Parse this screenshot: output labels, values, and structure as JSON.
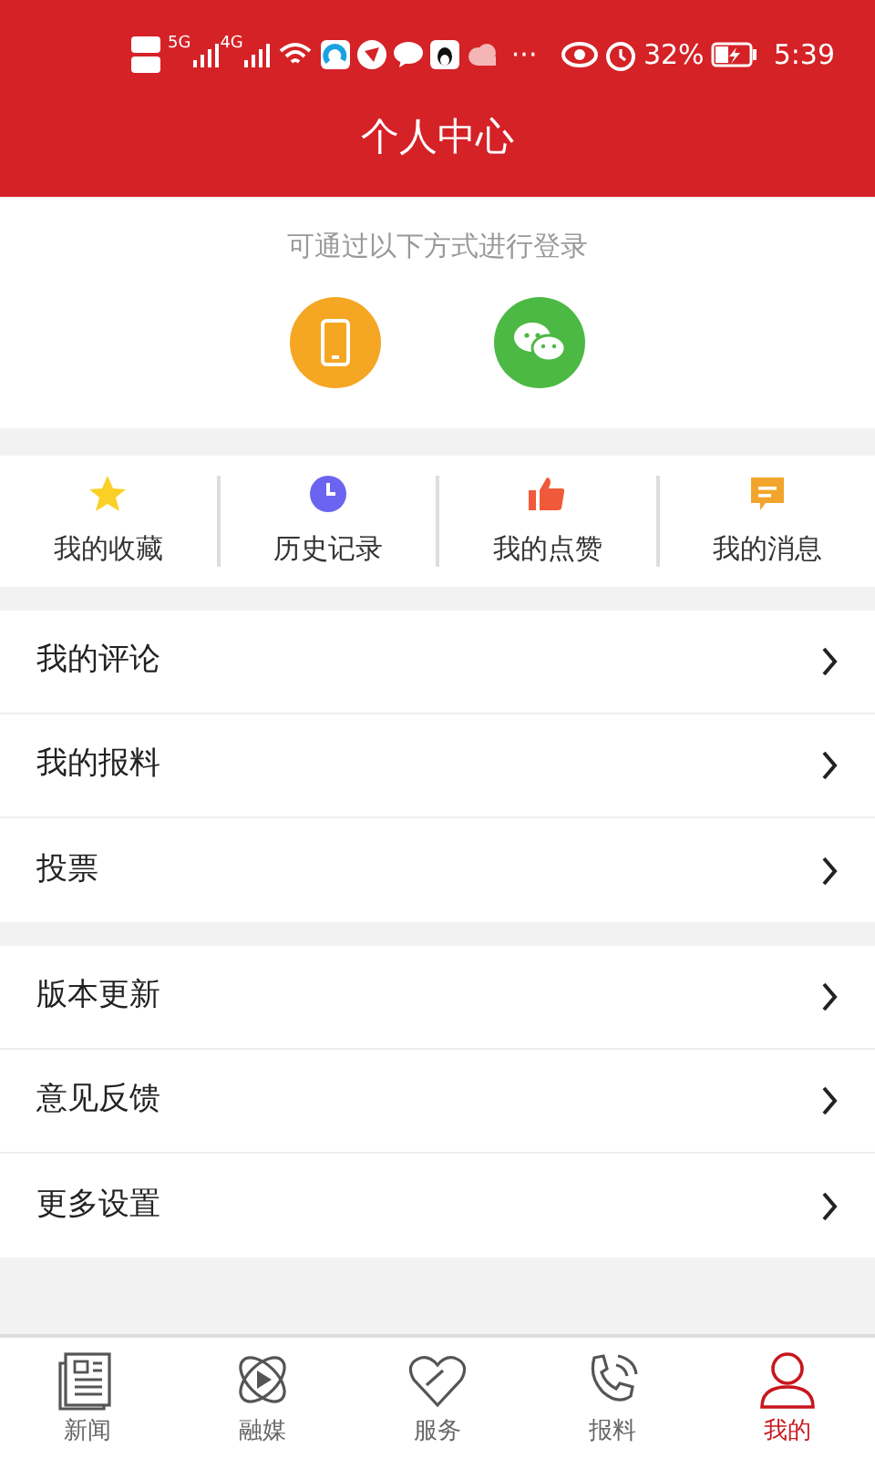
{
  "status_bar": {
    "networks": [
      "5G",
      "4G"
    ],
    "battery": "32%",
    "time": "5:39",
    "more": "···"
  },
  "header": {
    "title": "个人中心"
  },
  "login": {
    "hint": "可通过以下方式进行登录",
    "methods": [
      {
        "kind": "phone",
        "color": "#f5a623"
      },
      {
        "kind": "wechat",
        "color": "#4cb944"
      }
    ]
  },
  "quick_links": [
    {
      "kind": "star",
      "label": "我的收藏",
      "color": "#fbd026"
    },
    {
      "kind": "clock",
      "label": "历史记录",
      "color": "#6a64f0"
    },
    {
      "kind": "thumb",
      "label": "我的点赞",
      "color": "#f05a3a"
    },
    {
      "kind": "message",
      "label": "我的消息",
      "color": "#f2a52c"
    }
  ],
  "menu_groups": [
    [
      {
        "label": "我的评论"
      },
      {
        "label": "我的报料"
      },
      {
        "label": "投票"
      }
    ],
    [
      {
        "label": "版本更新"
      },
      {
        "label": "意见反馈"
      },
      {
        "label": "更多设置"
      }
    ]
  ],
  "tab_bar": [
    {
      "kind": "news",
      "label": "新闻",
      "selected": false
    },
    {
      "kind": "media",
      "label": "融媒",
      "selected": false
    },
    {
      "kind": "service",
      "label": "服务",
      "selected": false
    },
    {
      "kind": "report",
      "label": "报料",
      "selected": false
    },
    {
      "kind": "me",
      "label": "我的",
      "selected": true
    }
  ]
}
